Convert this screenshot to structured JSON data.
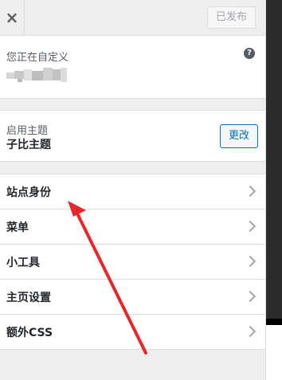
{
  "header": {
    "close_label": "×",
    "publish_label": "已发布"
  },
  "info": {
    "label": "您正在自定义",
    "help_label": "?"
  },
  "theme": {
    "label": "启用主题",
    "name": "子比主题",
    "change_label": "更改"
  },
  "sections": [
    {
      "label": "站点身份"
    },
    {
      "label": "菜单"
    },
    {
      "label": "小工具"
    },
    {
      "label": "主页设置"
    },
    {
      "label": "额外CSS"
    }
  ],
  "colors": {
    "accent": "#0073aa",
    "annotation_arrow": "#e8262b"
  },
  "icons": [
    "close-icon",
    "help-icon",
    "chevron-right-icon"
  ]
}
